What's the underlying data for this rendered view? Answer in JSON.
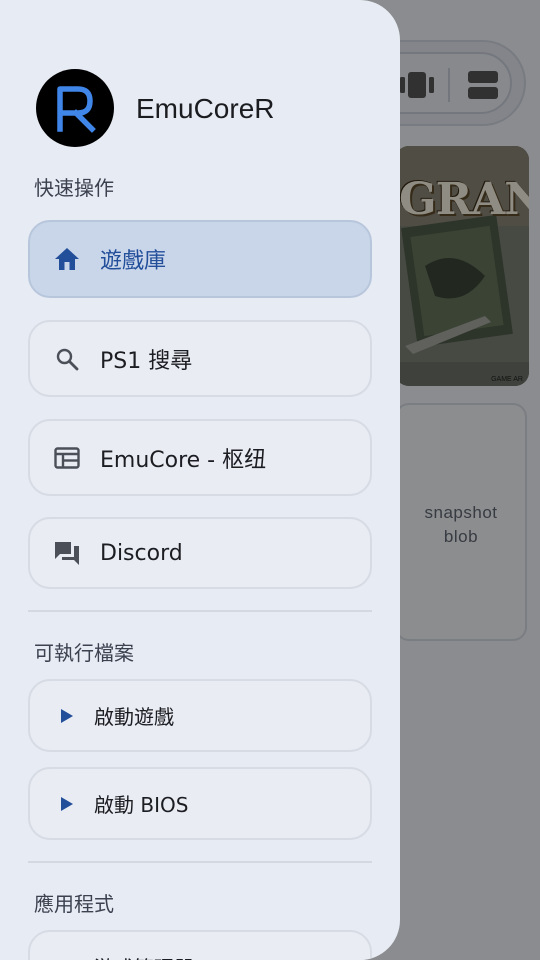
{
  "background": {
    "empty_card_text": "snapshot\nblob",
    "cover": {
      "title": "GRANDI",
      "caption": "GAME AR"
    }
  },
  "drawer": {
    "app_name": "EmuCoreR",
    "avatar_letter": "R",
    "sections": {
      "quick": "快速操作",
      "executables": "可執行檔案",
      "apps": "應用程式"
    },
    "quick_items": [
      {
        "label": "遊戲庫",
        "icon": "home-icon",
        "active": true
      },
      {
        "label": "PS1 搜尋",
        "icon": "search-icon",
        "active": false
      },
      {
        "label": "EmuCore - 枢纽",
        "icon": "web-hub-icon",
        "active": false
      },
      {
        "label": "Discord",
        "icon": "chat-forum-icon",
        "active": false
      }
    ],
    "exec_items": [
      {
        "label": "啟動遊戲",
        "icon": "play-icon"
      },
      {
        "label": "啟動 BIOS",
        "icon": "play-icon"
      }
    ],
    "app_items": [
      {
        "label": "游戏管理器",
        "icon": "gamepad-icon"
      }
    ]
  },
  "colors": {
    "accent": "#234e9a",
    "drawer_bg": "#e7ebf3",
    "active_bg": "#c9d6ea",
    "scrim": "rgba(0,0,0,0.42)"
  }
}
